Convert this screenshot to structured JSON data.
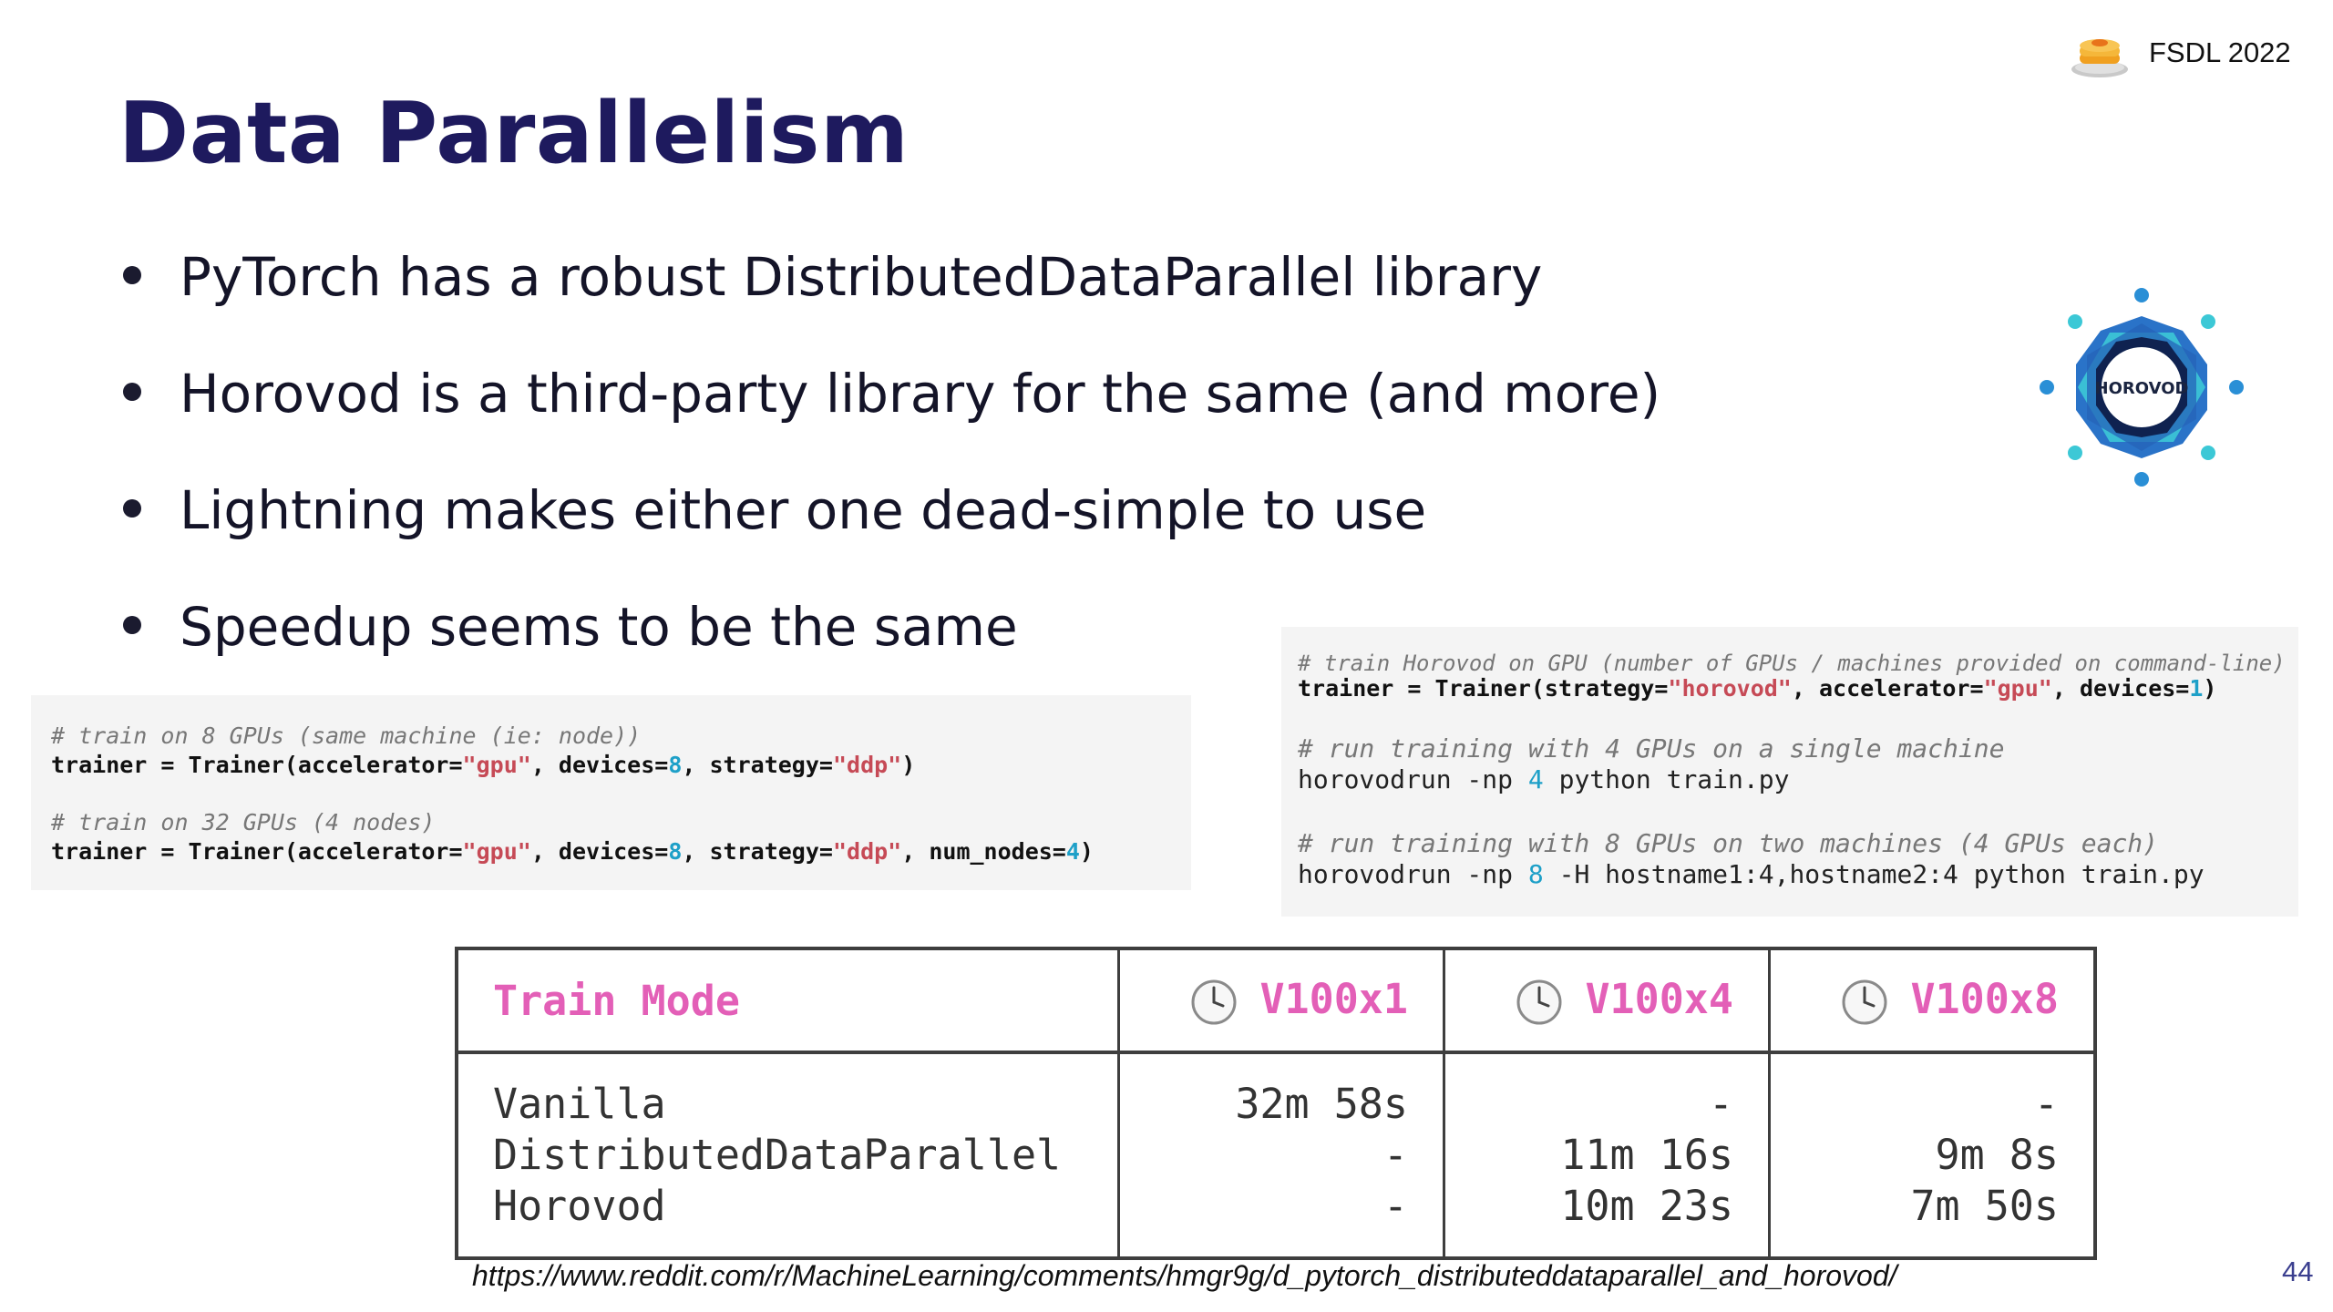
{
  "brand": {
    "text": "FSDL 2022",
    "logo_icon": "pancake-stack-icon"
  },
  "title": "Data Parallelism",
  "bullets": [
    "PyTorch has a robust DistributedDataParallel library",
    "Horovod is a third-party library for the same (and more)",
    "Lightning makes either one dead-simple to use",
    "Speedup seems to be the same"
  ],
  "horovod_logo": {
    "text": "HOROVOD",
    "icon": "horovod-logo-icon",
    "colors": [
      "#2a73c8",
      "#3cc8d6",
      "#0f2250"
    ]
  },
  "code_left": {
    "comment1": "# train on 8 GPUs (same machine (ie: node))",
    "l1_a": "trainer = Trainer(accelerator=",
    "l1_s1": "\"gpu\"",
    "l1_b": ", devices=",
    "l1_n1": "8",
    "l1_c": ", strategy=",
    "l1_s2": "\"ddp\"",
    "l1_d": ")",
    "comment2": "# train on 32 GPUs (4 nodes)",
    "l2_a": "trainer = Trainer(accelerator=",
    "l2_s1": "\"gpu\"",
    "l2_b": ", devices=",
    "l2_n1": "8",
    "l2_c": ", strategy=",
    "l2_s2": "\"ddp\"",
    "l2_d": ", num_nodes=",
    "l2_n2": "4",
    "l2_e": ")"
  },
  "code_right": {
    "comment1": "# train Horovod on GPU (number of GPUs / machines provided on command-line)",
    "l1_a": "trainer = Trainer(strategy=",
    "l1_s1": "\"horovod\"",
    "l1_b": ", accelerator=",
    "l1_s2": "\"gpu\"",
    "l1_c": ", devices=",
    "l1_n1": "1",
    "l1_d": ")",
    "comment2": "# run training with 4 GPUs on a single machine",
    "cmd1_a": "horovodrun -np ",
    "cmd1_n": "4",
    "cmd1_b": " python train.py",
    "comment3": "# run training with 8 GPUs on two machines (4 GPUs each)",
    "cmd2_a": "horovodrun -np ",
    "cmd2_n": "8",
    "cmd2_b": " -H hostname1:4,hostname2:4 python train.py"
  },
  "table": {
    "headers": [
      "Train Mode",
      "V100x1",
      "V100x4",
      "V100x8"
    ],
    "header_icon": "clock-icon",
    "header_color": "#e35fb7",
    "col_mode": "Vanilla\nDistributedDataParallel\nHorovod",
    "col_v1": "32m 58s\n-\n-",
    "col_v4": "-\n11m 16s\n10m 23s",
    "col_v8": "-\n9m 8s\n7m 50s",
    "rows": [
      {
        "mode": "Vanilla",
        "v100x1": "32m 58s",
        "v100x4": "-",
        "v100x8": "-"
      },
      {
        "mode": "DistributedDataParallel",
        "v100x1": "-",
        "v100x4": "11m 16s",
        "v100x8": "9m 8s"
      },
      {
        "mode": "Horovod",
        "v100x1": "-",
        "v100x4": "10m 23s",
        "v100x8": "7m 50s"
      }
    ]
  },
  "source": "https://www.reddit.com/r/MachineLearning/comments/hmgr9g/d_pytorch_distributeddataparallel_and_horovod/",
  "page_number": "44"
}
